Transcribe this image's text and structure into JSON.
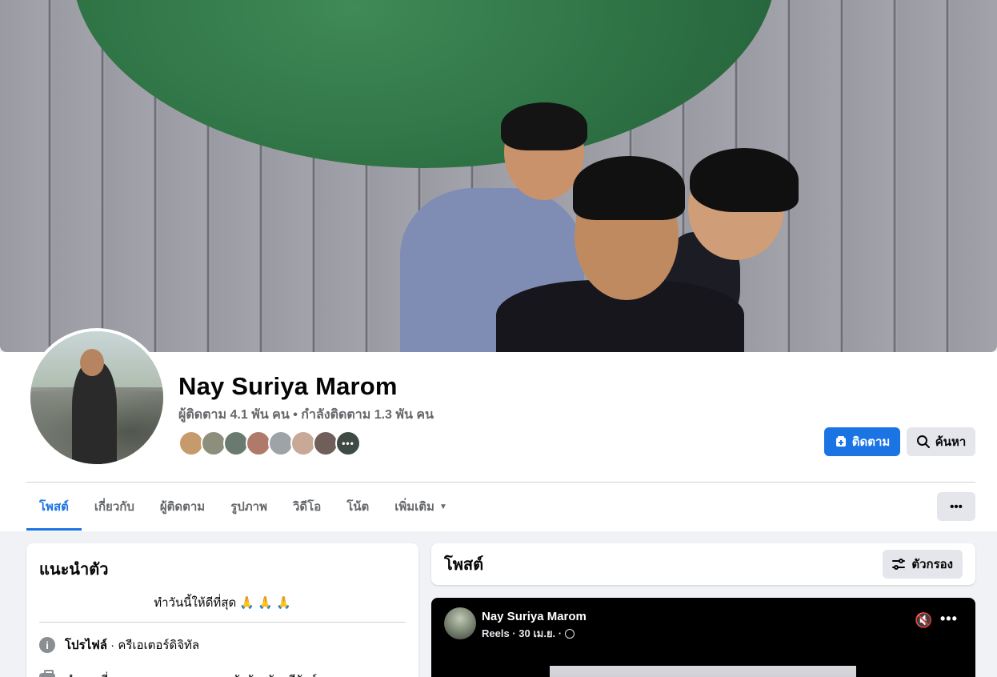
{
  "profile": {
    "name": "Nay Suriya Marom",
    "follow_stats": "ผู้ติดตาม 4.1 พัน คน • กำลังติดตาม 1.3 พัน คน",
    "friend_more": "•••"
  },
  "actions": {
    "follow_label": "ติดตาม",
    "search_label": "ค้นหา",
    "more_label": "•••"
  },
  "tabs": [
    {
      "label": "โพสต์"
    },
    {
      "label": "เกี่ยวกับ"
    },
    {
      "label": "ผู้ติดตาม"
    },
    {
      "label": "รูปภาพ"
    },
    {
      "label": "วิดีโอ"
    },
    {
      "label": "โน้ต"
    },
    {
      "label": "เพิ่มเติม"
    }
  ],
  "intro": {
    "title": "แนะนำตัว",
    "bio": "ทำวันนี้ให้ดีที่สุด 🙏 🙏 🙏",
    "profile_type_bold": "โปรไฟล์",
    "profile_type_rest": " · ครีเอเตอร์ดิจิทัล",
    "work": "ทำงานที่ ศาลเยาวชนและครอบครัวจังหวัดบุรีรัมย์"
  },
  "posts": {
    "title": "โพสต์",
    "filter_label": "ตัวกรอง"
  },
  "reel_post": {
    "author": "Nay Suriya Marom",
    "meta": "Reels · 30 เม.ย. ·"
  },
  "colors": {
    "accent": "#1b74e4",
    "background": "#f0f2f5",
    "secondary_text": "#65676b"
  }
}
